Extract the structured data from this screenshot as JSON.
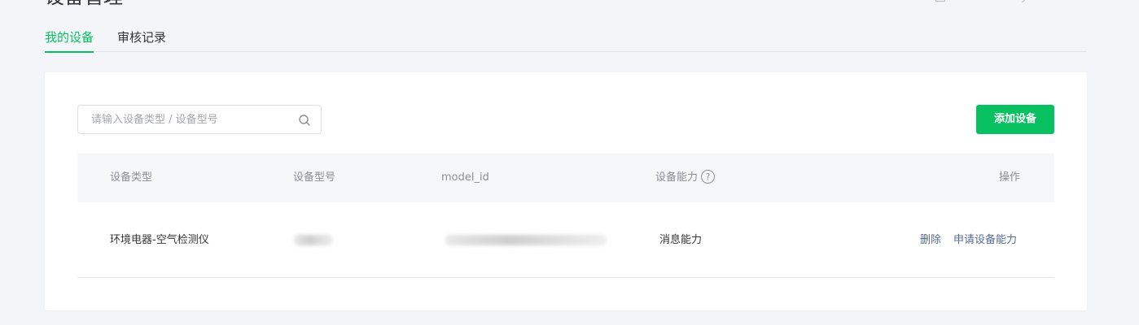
{
  "page": {
    "title": "设备管理"
  },
  "tabs": [
    {
      "label": "我的设备",
      "active": true
    },
    {
      "label": "审核记录",
      "active": false
    }
  ],
  "toolbar": {
    "search_placeholder": "请输入设备类型 / 设备型号",
    "search_value": "",
    "search_icon": "search-icon",
    "add_label": "添加设备"
  },
  "table": {
    "columns": [
      "设备类型",
      "设备型号",
      "model_id",
      "设备能力",
      "操作"
    ],
    "help_glyph": "?",
    "rows": [
      {
        "device_type": "环境电器-空气检测仪",
        "device_model": "",
        "model_id": "",
        "capability": "消息能力",
        "actions": [
          "删除",
          "申请设备能力"
        ]
      }
    ]
  },
  "colors": {
    "accent": "#07c160",
    "link": "#576b95",
    "background": "#f4f5f9",
    "header_bg": "#f6f7f9"
  }
}
